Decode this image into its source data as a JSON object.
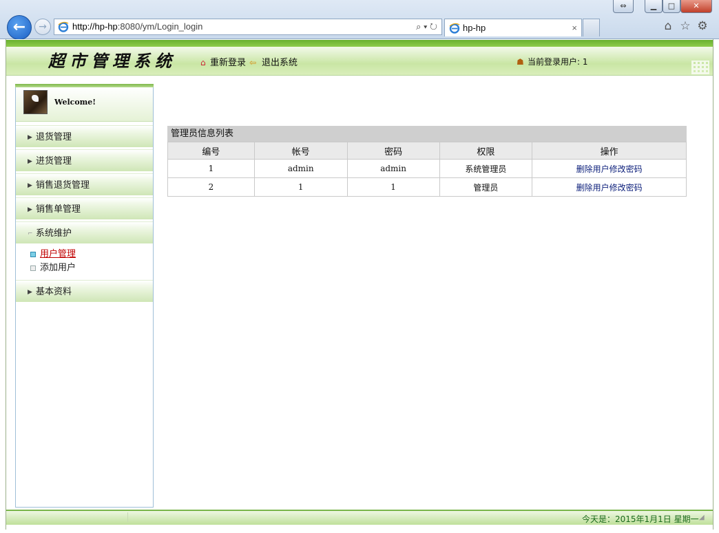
{
  "browser": {
    "url_host": "http://hp-hp",
    "url_rest": ":8080/ym/Login_login",
    "url_tools": "⌕ ▾ ↻",
    "tab_title": "hp-hp",
    "tab_close": "×",
    "win_restore": "⇔",
    "win_minimize": "▁",
    "win_maximize": "□",
    "win_close": "✕",
    "home_icon": "⌂",
    "star_icon": "☆",
    "gear_icon": "⚙"
  },
  "header": {
    "logo_text": "超市管理系统",
    "relogin_label": "重新登录",
    "logout_label": "退出系统",
    "current_user_label": "当前登录用户:",
    "current_user_value": "1"
  },
  "sidebar": {
    "welcome": "Welcome!",
    "items": [
      {
        "label": "退货管理",
        "marker": "▶"
      },
      {
        "label": "进货管理",
        "marker": "▶"
      },
      {
        "label": "销售退货管理",
        "marker": "▶"
      },
      {
        "label": "销售单管理",
        "marker": "▶"
      },
      {
        "label": "系统维护",
        "marker": "⌐"
      },
      {
        "label": "基本资料",
        "marker": "▶"
      }
    ],
    "sub_items": [
      {
        "label": "用户管理",
        "active": true
      },
      {
        "label": "添加用户",
        "active": false
      }
    ]
  },
  "table": {
    "caption": "管理员信息列表",
    "columns": [
      "编号",
      "帐号",
      "密码",
      "权限",
      "操作"
    ],
    "rows": [
      {
        "id": "1",
        "account": "admin",
        "password": "admin",
        "role": "系统管理员",
        "action_delete": "删除用户",
        "action_modify": "修改密码"
      },
      {
        "id": "2",
        "account": "1",
        "password": "1",
        "role": "管理员",
        "action_delete": "删除用户",
        "action_modify": "修改密码"
      }
    ]
  },
  "footer": {
    "date_text": "今天是：2015年1月1日  星期一"
  }
}
